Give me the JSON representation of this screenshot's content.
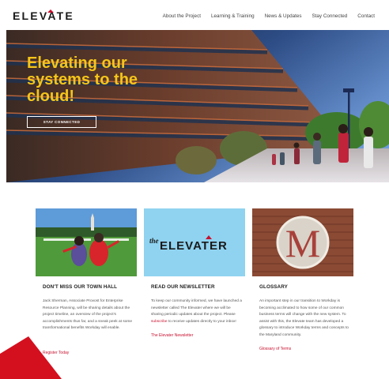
{
  "header": {
    "logo": "ELEVATE",
    "nav": [
      "About the Project",
      "Learning & Training",
      "News & Updates",
      "Stay Connected",
      "Contact"
    ]
  },
  "hero": {
    "title": "Elevating our systems to the cloud!",
    "button": "STAY CONNECTED"
  },
  "cards": [
    {
      "title": "DON'T MISS OUR TOWN HALL",
      "body": "Jack Sherman, Associate Provost for Enterprise Resource Planning, will be sharing details about the project timeline, an overview of the project's accomplishments thus far, and a sneak peek at some transformational benefits Workday will enable.",
      "link": "Register Today"
    },
    {
      "title": "READ OUR NEWSLETTER",
      "banner_prefix": "the",
      "banner_word": "ELEVATER",
      "body_a": "To keep our community informed, we have launched a newsletter called The Elevater where we will be sharing periodic updates about the project. Please ",
      "body_link": "subscribe",
      "body_b": " to receive updates directly to your inbox!",
      "link": "The Elevater Newsletter"
    },
    {
      "title": "GLOSSARY",
      "sign_letter": "M",
      "body": "An important step in our transition to Workday is becoming acclimated to how some of our common business terms will change with the new system. To assist with this, the Elevate team has developed a glossary to introduce Workday terms and concepts to the Maryland community.",
      "link": "Glossary of Terms"
    }
  ],
  "colors": {
    "accent": "#c8102e",
    "hero_title": "#f5c518",
    "sky": "#8fd3f0"
  }
}
